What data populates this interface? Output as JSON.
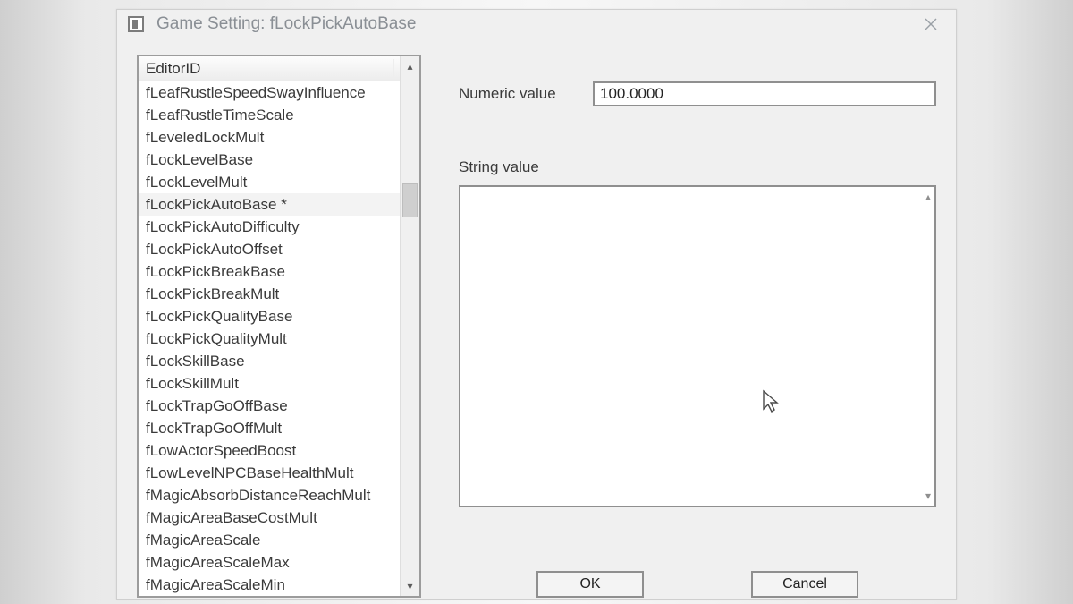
{
  "window": {
    "title": "Game Setting: fLockPickAutoBase"
  },
  "list": {
    "column_header": "EditorID",
    "selected_index": 5,
    "items": [
      "fLeafRustleSpeedSwayInfluence",
      "fLeafRustleTimeScale",
      "fLeveledLockMult",
      "fLockLevelBase",
      "fLockLevelMult",
      "fLockPickAutoBase *",
      "fLockPickAutoDifficulty",
      "fLockPickAutoOffset",
      "fLockPickBreakBase",
      "fLockPickBreakMult",
      "fLockPickQualityBase",
      "fLockPickQualityMult",
      "fLockSkillBase",
      "fLockSkillMult",
      "fLockTrapGoOffBase",
      "fLockTrapGoOffMult",
      "fLowActorSpeedBoost",
      "fLowLevelNPCBaseHealthMult",
      "fMagicAbsorbDistanceReachMult",
      "fMagicAreaBaseCostMult",
      "fMagicAreaScale",
      "fMagicAreaScaleMax",
      "fMagicAreaScaleMin"
    ]
  },
  "fields": {
    "numeric_label": "Numeric value",
    "numeric_value": "100.0000",
    "string_label": "String value",
    "string_value": ""
  },
  "buttons": {
    "ok": "OK",
    "cancel": "Cancel"
  }
}
